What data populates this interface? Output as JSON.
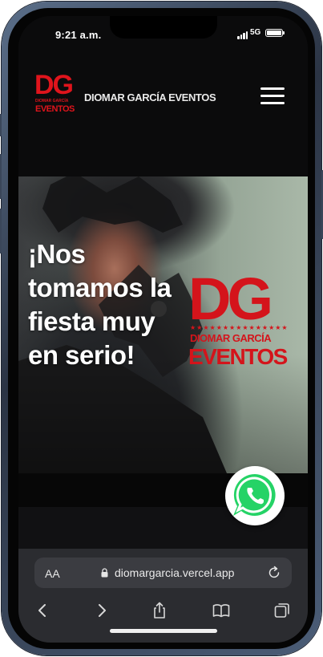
{
  "status_bar": {
    "time": "9:21 a.m.",
    "network": "5G"
  },
  "header": {
    "logo": {
      "mark": "DG",
      "subtitle": "DIOMAR GARCÍA",
      "wordmark": "EVENTOS"
    },
    "brand_name": "DIOMAR GARCÍA EVENTOS",
    "menu_icon": "hamburger-icon"
  },
  "hero": {
    "title": "¡Nos tomamos la fiesta muy en serio!",
    "logo": {
      "mark": "DG",
      "stars": "★★★★★★★★★★★★★★★",
      "subtitle": "DIOMAR GARCÍA",
      "wordmark": "EVENTOS"
    }
  },
  "floating": {
    "whatsapp_icon": "whatsapp-icon"
  },
  "browser": {
    "text_size_label": "AA",
    "url": "diomargarcia.vercel.app",
    "icons": [
      "back-icon",
      "forward-icon",
      "share-icon",
      "bookmarks-icon",
      "tabs-icon"
    ]
  },
  "colors": {
    "brand_red": "#d4141b",
    "whatsapp_green": "#25d366",
    "background": "#0b0b0c"
  }
}
